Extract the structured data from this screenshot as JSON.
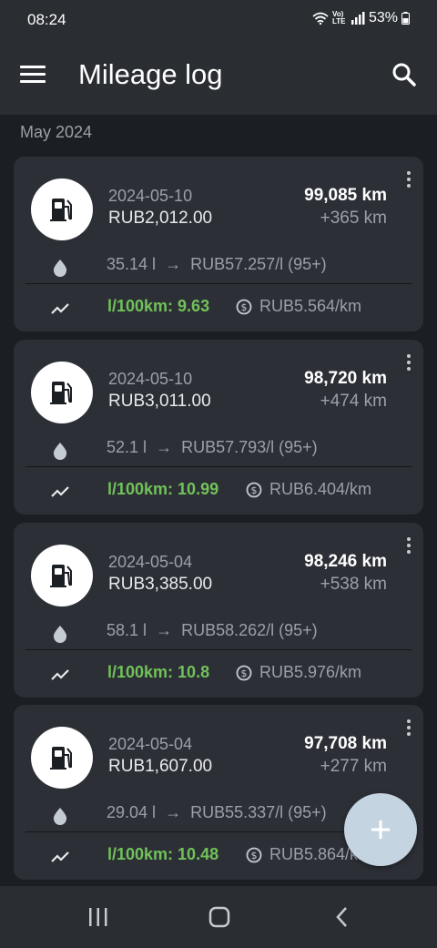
{
  "status": {
    "time": "08:24",
    "battery": "53%",
    "volte": "Vo) LTE"
  },
  "appbar": {
    "title": "Mileage log"
  },
  "section": "May 2024",
  "entries": [
    {
      "date": "2024-05-10",
      "cost": "RUB2,012.00",
      "odometer": "99,085 km",
      "distance": "+365 km",
      "volume": "35.14 l",
      "arrow": "→",
      "price": "RUB57.257/l (95+)",
      "consumption": "l/100km: 9.63",
      "cost_per_km": "RUB5.564/km"
    },
    {
      "date": "2024-05-10",
      "cost": "RUB3,011.00",
      "odometer": "98,720 km",
      "distance": "+474 km",
      "volume": "52.1 l",
      "arrow": "→",
      "price": "RUB57.793/l (95+)",
      "consumption": "l/100km: 10.99",
      "cost_per_km": "RUB6.404/km"
    },
    {
      "date": "2024-05-04",
      "cost": "RUB3,385.00",
      "odometer": "98,246 km",
      "distance": "+538 km",
      "volume": "58.1 l",
      "arrow": "→",
      "price": "RUB58.262/l (95+)",
      "consumption": "l/100km: 10.8",
      "cost_per_km": "RUB5.976/km"
    },
    {
      "date": "2024-05-04",
      "cost": "RUB1,607.00",
      "odometer": "97,708 km",
      "distance": "+277 km",
      "volume": "29.04 l",
      "arrow": "→",
      "price": "RUB55.337/l (95+)",
      "consumption": "l/100km: 10.48",
      "cost_per_km": "RUB5.864/km"
    }
  ],
  "icons": {
    "menu": "hamburger-menu-icon",
    "search": "search-icon",
    "fuel": "fuel-pump-icon",
    "drop": "water-drop-icon",
    "trend": "trending-line-icon",
    "dollar": "dollar-circle-icon",
    "more": "more-vertical-icon",
    "add": "plus-icon",
    "nav_recents": "recent-apps-icon",
    "nav_home": "home-icon",
    "nav_back": "back-icon"
  },
  "colors": {
    "background": "#1b1e23",
    "card": "#2c3036",
    "bar": "#2a2e33",
    "accent_green": "#72c15a",
    "fab": "#c5d4e1"
  }
}
